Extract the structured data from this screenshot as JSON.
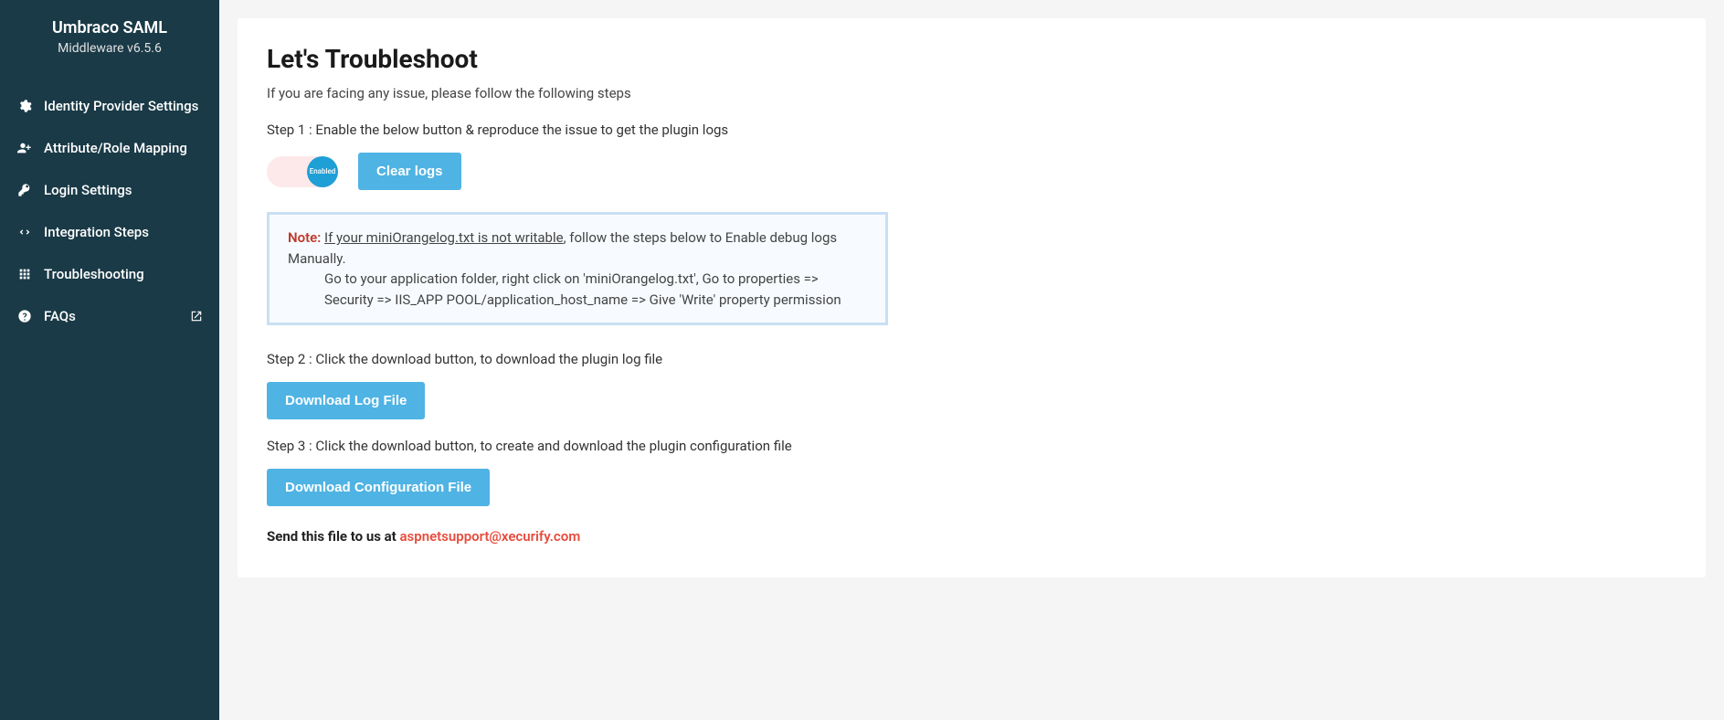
{
  "sidebar": {
    "title": "Umbraco SAML",
    "subtitle": "Middleware v6.5.6",
    "items": [
      {
        "label": "Identity Provider Settings",
        "icon": "gears-icon"
      },
      {
        "label": "Attribute/Role Mapping",
        "icon": "user-plus-icon"
      },
      {
        "label": "Login Settings",
        "icon": "key-icon"
      },
      {
        "label": "Integration Steps",
        "icon": "code-icon"
      },
      {
        "label": "Troubleshooting",
        "icon": "grid-icon"
      },
      {
        "label": "FAQs",
        "icon": "question-icon",
        "external": true
      }
    ]
  },
  "main": {
    "title": "Let's Troubleshoot",
    "intro": "If you are facing any issue, please follow the following steps",
    "step1": "Step 1 : Enable the below button & reproduce the issue to get the plugin logs",
    "toggle_label": "Enabled",
    "clear_logs": "Clear logs",
    "note": {
      "label": "Note:",
      "underlined": "If your miniOrangelog.txt is not writable",
      "after": ", follow the steps below to Enable debug logs Manually.",
      "line2": "Go to your application folder, right click on 'miniOrangelog.txt', Go to properties => Security => IIS_APP POOL/application_host_name => Give 'Write' property permission"
    },
    "step2": "Step 2 : Click the download button, to download the plugin log file",
    "download_log": "Download Log File",
    "step3": "Step 3 : Click the download button, to create and download the plugin configuration file",
    "download_config": "Download Configuration File",
    "send_prefix": "Send this file to us at ",
    "send_email": "aspnetsupport@xecurify.com"
  }
}
